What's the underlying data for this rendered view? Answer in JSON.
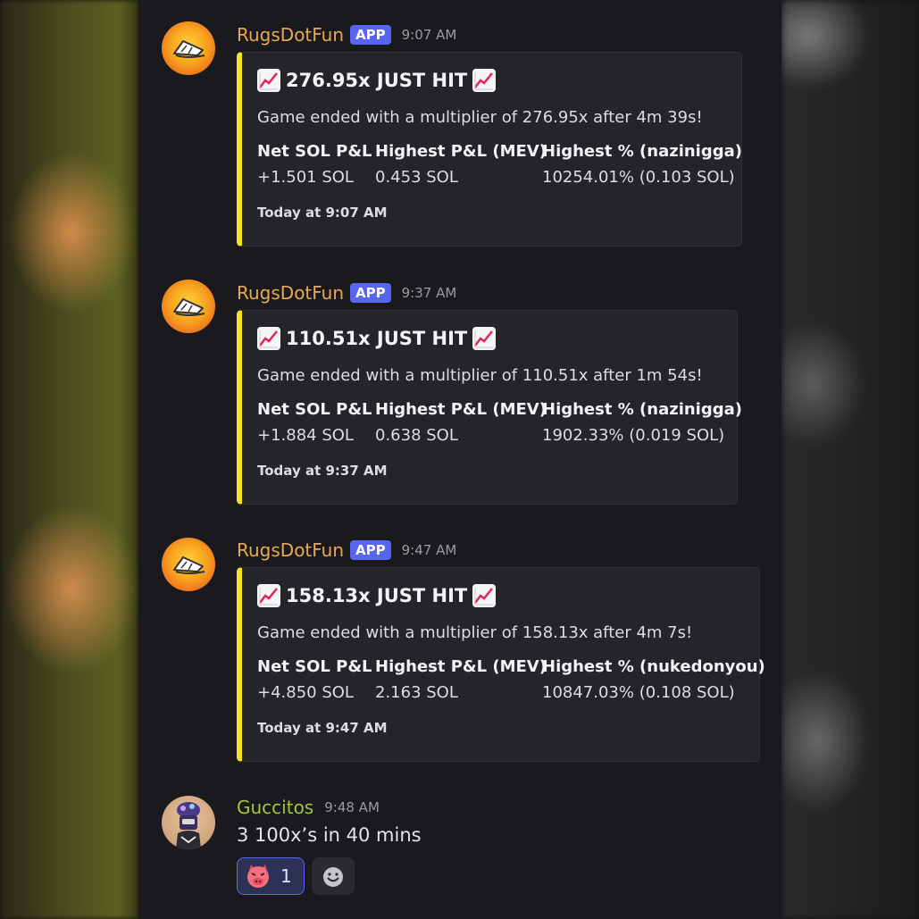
{
  "messages": [
    {
      "author": "RugsDotFun",
      "badge": "APP",
      "time": "9:07 AM",
      "embed": {
        "title": "276.95x JUST HIT",
        "description": "Game ended with a multiplier of 276.95x after 4m 39s!",
        "fields": [
          {
            "name": "Net SOL P&L",
            "value": "+1.501 SOL"
          },
          {
            "name": "Highest P&L (MEV)",
            "value": "0.453 SOL"
          },
          {
            "name": "Highest % (nazinigga)",
            "value": "10254.01% (0.103 SOL)"
          }
        ],
        "footer": "Today at 9:07 AM"
      }
    },
    {
      "author": "RugsDotFun",
      "badge": "APP",
      "time": "9:37 AM",
      "embed": {
        "title": "110.51x JUST HIT",
        "description": "Game ended with a multiplier of 110.51x after 1m 54s!",
        "fields": [
          {
            "name": "Net SOL P&L",
            "value": "+1.884 SOL"
          },
          {
            "name": "Highest P&L (MEV)",
            "value": "0.638 SOL"
          },
          {
            "name": "Highest % (nazinigga)",
            "value": "1902.33% (0.019 SOL)"
          }
        ],
        "footer": "Today at 9:37 AM"
      }
    },
    {
      "author": "RugsDotFun",
      "badge": "APP",
      "time": "9:47 AM",
      "embed": {
        "title": "158.13x JUST HIT",
        "description": "Game ended with a multiplier of 158.13x after 4m 7s!",
        "fields": [
          {
            "name": "Net SOL P&L",
            "value": "+4.850 SOL"
          },
          {
            "name": "Highest P&L (MEV)",
            "value": "2.163 SOL"
          },
          {
            "name": "Highest % (nukedonyou)",
            "value": "10847.03% (0.108 SOL)"
          }
        ],
        "footer": "Today at 9:47 AM"
      }
    },
    {
      "author": "Guccitos",
      "time": "9:48 AM",
      "text": "3 100x’s in 40 mins",
      "reactions": [
        {
          "icon": "devil-face-icon",
          "count": "1"
        }
      ]
    }
  ],
  "colors": {
    "bot_author": "#e9a855",
    "user_author": "#a5c53a",
    "badge": "#5865f2",
    "embed_accent": "#f5e32a"
  }
}
